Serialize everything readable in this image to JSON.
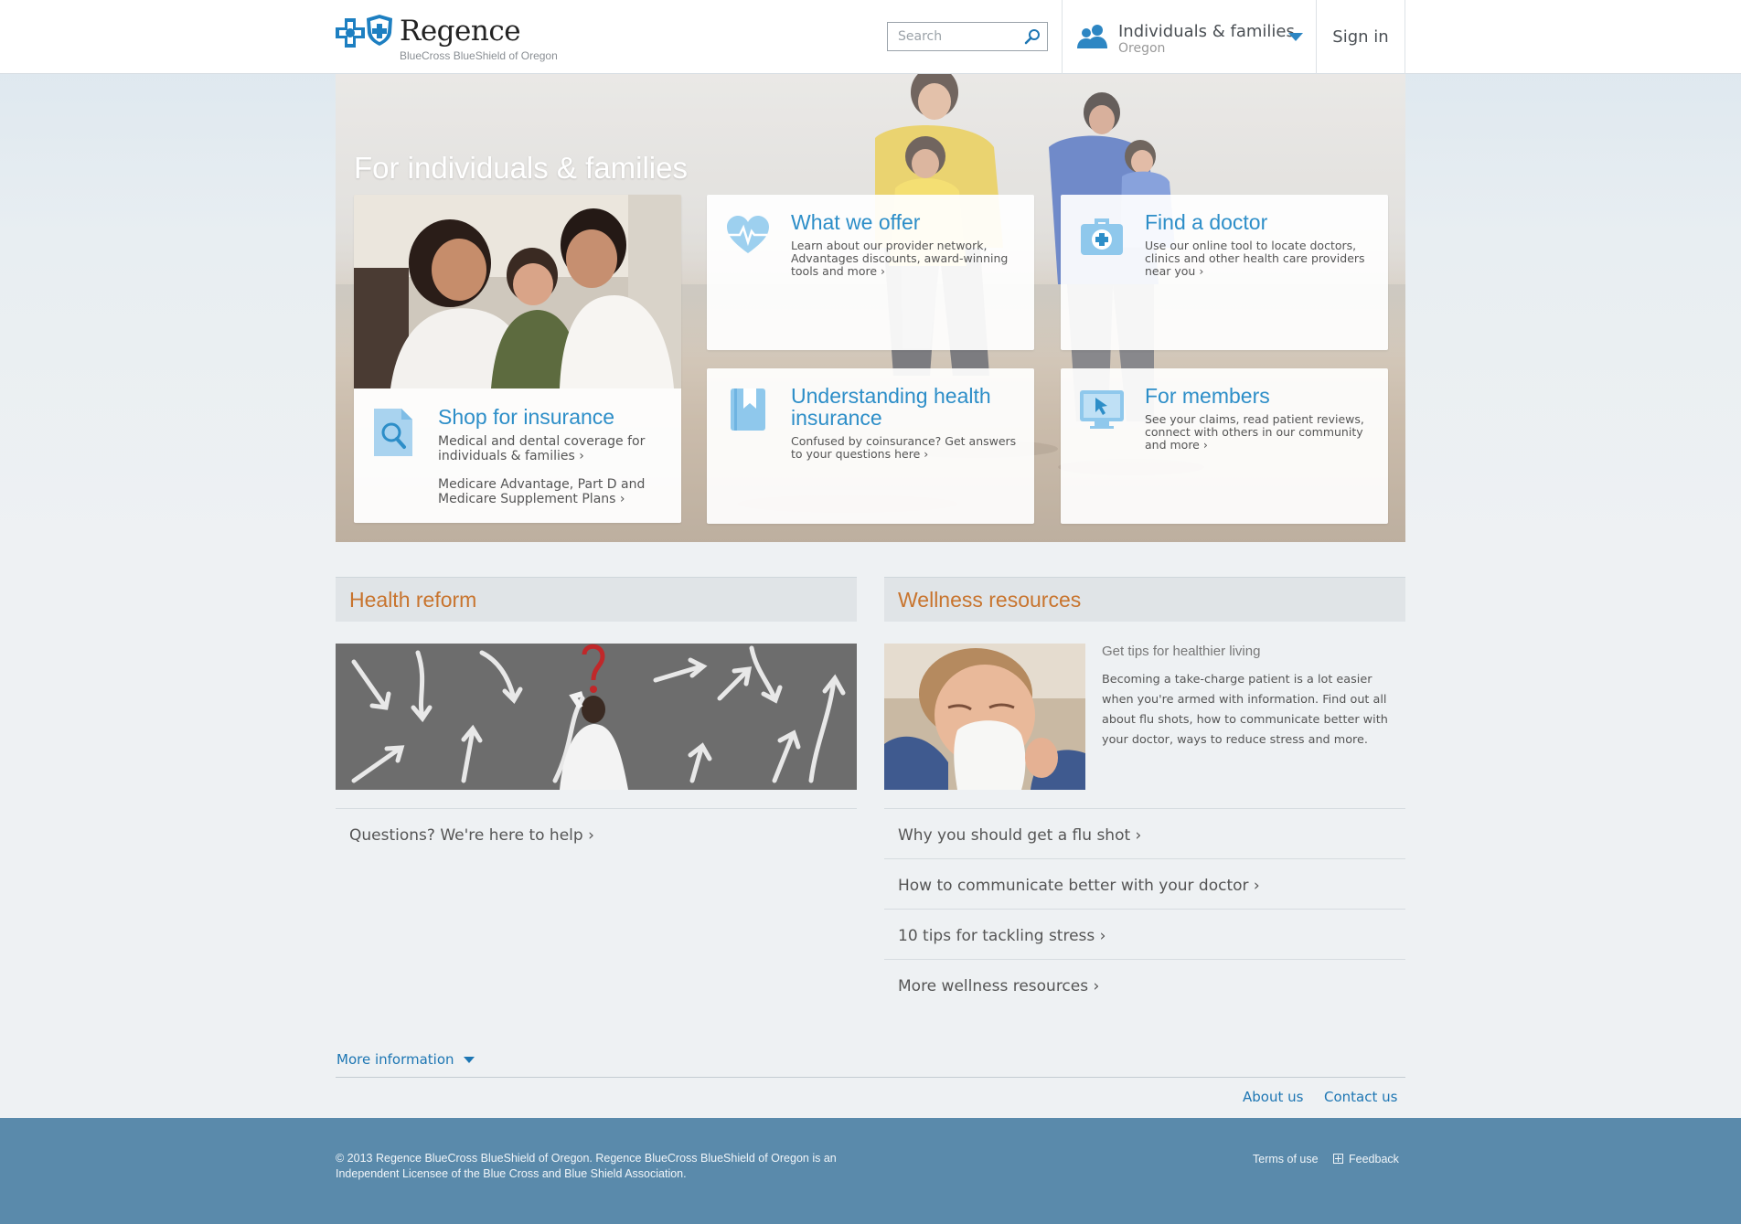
{
  "brand": {
    "name": "Regence",
    "subtitle": "BlueCross BlueShield of Oregon",
    "accent_color": "#2d8ec8",
    "section_heading_color": "#c8742e"
  },
  "header": {
    "search_placeholder": "Search",
    "audience_title": "Individuals & families",
    "audience_region": "Oregon",
    "signin_label": "Sign in"
  },
  "hero": {
    "title": "For individuals & families",
    "shop": {
      "title": "Shop for insurance",
      "desc": "Medical and dental coverage for individuals & families ›",
      "desc2": "Medicare Advantage, Part D and Medicare Supplement Plans ›",
      "icon": "search-document-icon"
    },
    "cards": [
      {
        "title": "What we offer",
        "desc": "Learn about our provider network, Advantages discounts, award-winning tools and more ›",
        "icon": "heart-pulse-icon"
      },
      {
        "title": "Find a doctor",
        "desc": "Use our online tool to locate doctors, clinics and other health care providers near you ›",
        "icon": "medical-kit-icon"
      },
      {
        "title": "Understanding health insurance",
        "desc": "Confused by coinsurance? Get answers to your questions here ›",
        "icon": "bookmark-book-icon"
      },
      {
        "title": "For members",
        "desc": "See your claims, read patient reviews, connect with others in our community and more ›",
        "icon": "monitor-cursor-icon"
      }
    ]
  },
  "health_reform": {
    "heading": "Health reform",
    "link": "Questions? We're here to help ›"
  },
  "wellness": {
    "heading": "Wellness resources",
    "tagline": "Get tips for healthier living",
    "text": "Becoming a take-charge patient is a lot easier when you're armed with information. Find out all about flu shots, how to communicate better with your doctor, ways to reduce stress and more.",
    "links": [
      "Why you should get a flu shot ›",
      "How to communicate better with your doctor ›",
      "10 tips for tackling stress ›",
      "More wellness resources ›"
    ]
  },
  "more_info": "More information",
  "footer_links": {
    "about": "About us",
    "contact": "Contact us"
  },
  "footer": {
    "copyright": "© 2013 Regence BlueCross BlueShield of Oregon. Regence BlueCross BlueShield of Oregon is an Independent Licensee of the Blue Cross and Blue Shield Association.",
    "terms": "Terms of use",
    "feedback": "Feedback"
  }
}
